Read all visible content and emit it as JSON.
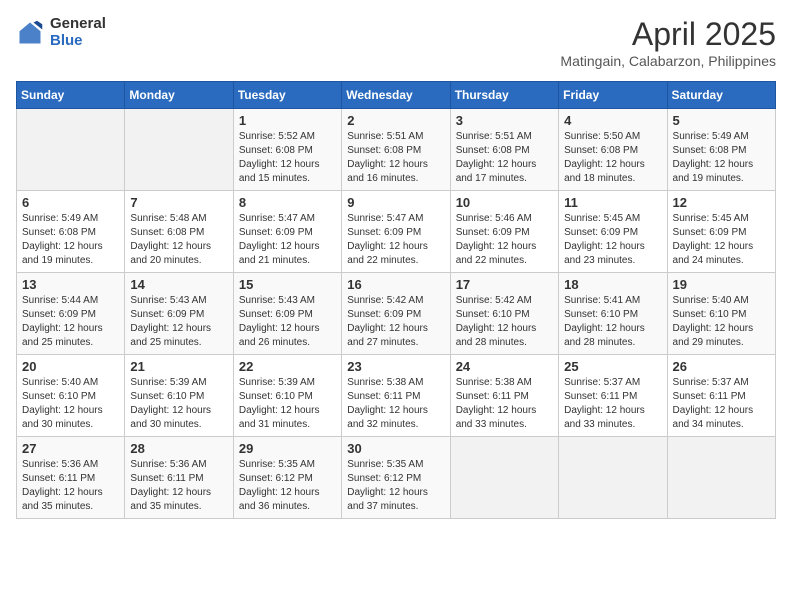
{
  "header": {
    "logo_general": "General",
    "logo_blue": "Blue",
    "month": "April 2025",
    "location": "Matingain, Calabarzon, Philippines"
  },
  "days_of_week": [
    "Sunday",
    "Monday",
    "Tuesday",
    "Wednesday",
    "Thursday",
    "Friday",
    "Saturday"
  ],
  "weeks": [
    [
      {
        "day": "",
        "info": ""
      },
      {
        "day": "",
        "info": ""
      },
      {
        "day": "1",
        "info": "Sunrise: 5:52 AM\nSunset: 6:08 PM\nDaylight: 12 hours and 15 minutes."
      },
      {
        "day": "2",
        "info": "Sunrise: 5:51 AM\nSunset: 6:08 PM\nDaylight: 12 hours and 16 minutes."
      },
      {
        "day": "3",
        "info": "Sunrise: 5:51 AM\nSunset: 6:08 PM\nDaylight: 12 hours and 17 minutes."
      },
      {
        "day": "4",
        "info": "Sunrise: 5:50 AM\nSunset: 6:08 PM\nDaylight: 12 hours and 18 minutes."
      },
      {
        "day": "5",
        "info": "Sunrise: 5:49 AM\nSunset: 6:08 PM\nDaylight: 12 hours and 19 minutes."
      }
    ],
    [
      {
        "day": "6",
        "info": "Sunrise: 5:49 AM\nSunset: 6:08 PM\nDaylight: 12 hours and 19 minutes."
      },
      {
        "day": "7",
        "info": "Sunrise: 5:48 AM\nSunset: 6:08 PM\nDaylight: 12 hours and 20 minutes."
      },
      {
        "day": "8",
        "info": "Sunrise: 5:47 AM\nSunset: 6:09 PM\nDaylight: 12 hours and 21 minutes."
      },
      {
        "day": "9",
        "info": "Sunrise: 5:47 AM\nSunset: 6:09 PM\nDaylight: 12 hours and 22 minutes."
      },
      {
        "day": "10",
        "info": "Sunrise: 5:46 AM\nSunset: 6:09 PM\nDaylight: 12 hours and 22 minutes."
      },
      {
        "day": "11",
        "info": "Sunrise: 5:45 AM\nSunset: 6:09 PM\nDaylight: 12 hours and 23 minutes."
      },
      {
        "day": "12",
        "info": "Sunrise: 5:45 AM\nSunset: 6:09 PM\nDaylight: 12 hours and 24 minutes."
      }
    ],
    [
      {
        "day": "13",
        "info": "Sunrise: 5:44 AM\nSunset: 6:09 PM\nDaylight: 12 hours and 25 minutes."
      },
      {
        "day": "14",
        "info": "Sunrise: 5:43 AM\nSunset: 6:09 PM\nDaylight: 12 hours and 25 minutes."
      },
      {
        "day": "15",
        "info": "Sunrise: 5:43 AM\nSunset: 6:09 PM\nDaylight: 12 hours and 26 minutes."
      },
      {
        "day": "16",
        "info": "Sunrise: 5:42 AM\nSunset: 6:09 PM\nDaylight: 12 hours and 27 minutes."
      },
      {
        "day": "17",
        "info": "Sunrise: 5:42 AM\nSunset: 6:10 PM\nDaylight: 12 hours and 28 minutes."
      },
      {
        "day": "18",
        "info": "Sunrise: 5:41 AM\nSunset: 6:10 PM\nDaylight: 12 hours and 28 minutes."
      },
      {
        "day": "19",
        "info": "Sunrise: 5:40 AM\nSunset: 6:10 PM\nDaylight: 12 hours and 29 minutes."
      }
    ],
    [
      {
        "day": "20",
        "info": "Sunrise: 5:40 AM\nSunset: 6:10 PM\nDaylight: 12 hours and 30 minutes."
      },
      {
        "day": "21",
        "info": "Sunrise: 5:39 AM\nSunset: 6:10 PM\nDaylight: 12 hours and 30 minutes."
      },
      {
        "day": "22",
        "info": "Sunrise: 5:39 AM\nSunset: 6:10 PM\nDaylight: 12 hours and 31 minutes."
      },
      {
        "day": "23",
        "info": "Sunrise: 5:38 AM\nSunset: 6:11 PM\nDaylight: 12 hours and 32 minutes."
      },
      {
        "day": "24",
        "info": "Sunrise: 5:38 AM\nSunset: 6:11 PM\nDaylight: 12 hours and 33 minutes."
      },
      {
        "day": "25",
        "info": "Sunrise: 5:37 AM\nSunset: 6:11 PM\nDaylight: 12 hours and 33 minutes."
      },
      {
        "day": "26",
        "info": "Sunrise: 5:37 AM\nSunset: 6:11 PM\nDaylight: 12 hours and 34 minutes."
      }
    ],
    [
      {
        "day": "27",
        "info": "Sunrise: 5:36 AM\nSunset: 6:11 PM\nDaylight: 12 hours and 35 minutes."
      },
      {
        "day": "28",
        "info": "Sunrise: 5:36 AM\nSunset: 6:11 PM\nDaylight: 12 hours and 35 minutes."
      },
      {
        "day": "29",
        "info": "Sunrise: 5:35 AM\nSunset: 6:12 PM\nDaylight: 12 hours and 36 minutes."
      },
      {
        "day": "30",
        "info": "Sunrise: 5:35 AM\nSunset: 6:12 PM\nDaylight: 12 hours and 37 minutes."
      },
      {
        "day": "",
        "info": ""
      },
      {
        "day": "",
        "info": ""
      },
      {
        "day": "",
        "info": ""
      }
    ]
  ]
}
